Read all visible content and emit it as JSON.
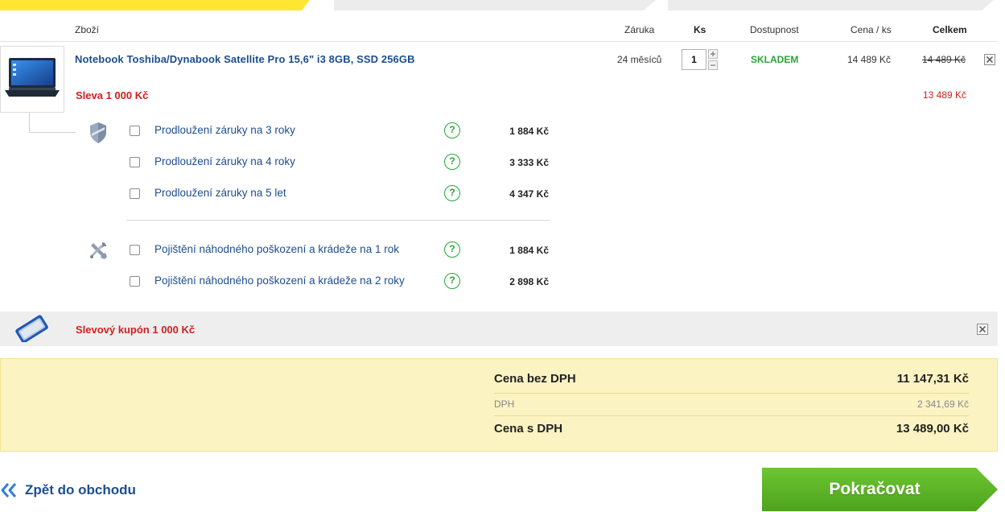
{
  "colors": {
    "accent_yellow": "#fee633",
    "link_blue": "#1d4d8f",
    "discount_red": "#d01f1f",
    "stock_green": "#2aa33a",
    "summary_bg": "#fcf3c2",
    "continue_green": "#5fb92a"
  },
  "table_header": {
    "goods": "Zboží",
    "warranty": "Záruka",
    "qty": "Ks",
    "availability": "Dostupnost",
    "unit_price": "Cena / ks",
    "total": "Celkem"
  },
  "product": {
    "name": "Notebook Toshiba/Dynabook Satellite Pro 15,6\" i3 8GB, SSD 256GB",
    "warranty": "24 měsíců",
    "qty": "1",
    "availability": "SKLADEM",
    "unit_price": "14 489 Kč",
    "total_original": "14 489 Kč",
    "discount_label": "Sleva 1 000 Kč",
    "total_discounted": "13 489 Kč",
    "image_icon": "laptop-icon",
    "remove_icon": "close-icon"
  },
  "services": {
    "warranty_icon": "shield-icon",
    "insurance_icon": "tools-icon",
    "help_glyph": "?",
    "warranty_options": [
      {
        "label": "Prodloužení záruky na 3 roky",
        "price": "1 884 Kč"
      },
      {
        "label": "Prodloužení záruky na 4 roky",
        "price": "3 333 Kč"
      },
      {
        "label": "Prodloužení záruky na 5 let",
        "price": "4 347 Kč"
      }
    ],
    "insurance_options": [
      {
        "label": "Pojištění náhodného poškození a krádeže na 1 rok",
        "price": "1 884 Kč"
      },
      {
        "label": "Pojištění náhodného poškození a krádeže na 2 roky",
        "price": "2 898 Kč"
      }
    ]
  },
  "coupon": {
    "label": "Slevový kupón 1 000 Kč",
    "icon": "coupon-icon"
  },
  "summary": {
    "price_without_vat_label": "Cena bez DPH",
    "price_without_vat": "11 147,31 Kč",
    "vat_label": "DPH",
    "vat": "2 341,69 Kč",
    "price_with_vat_label": "Cena s DPH",
    "price_with_vat": "13 489,00 Kč"
  },
  "footer": {
    "back_label": "Zpět do obchodu",
    "back_icon": "double-chevron-left-icon",
    "continue_label": "Pokračovat"
  }
}
